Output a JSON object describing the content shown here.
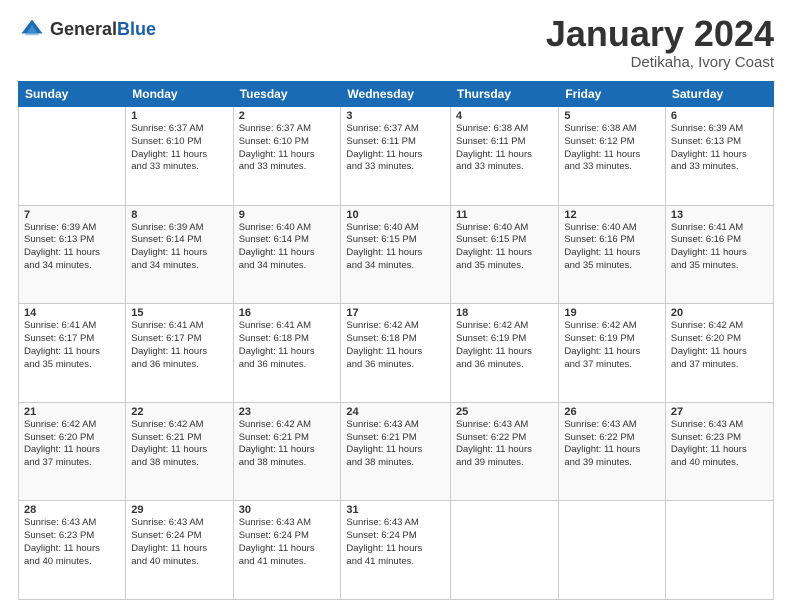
{
  "logo": {
    "general": "General",
    "blue": "Blue"
  },
  "title": "January 2024",
  "location": "Detikaha, Ivory Coast",
  "days_header": [
    "Sunday",
    "Monday",
    "Tuesday",
    "Wednesday",
    "Thursday",
    "Friday",
    "Saturday"
  ],
  "weeks": [
    [
      {
        "day": "",
        "sunrise": "",
        "sunset": "",
        "daylight": ""
      },
      {
        "day": "1",
        "sunrise": "Sunrise: 6:37 AM",
        "sunset": "Sunset: 6:10 PM",
        "daylight": "Daylight: 11 hours and 33 minutes."
      },
      {
        "day": "2",
        "sunrise": "Sunrise: 6:37 AM",
        "sunset": "Sunset: 6:10 PM",
        "daylight": "Daylight: 11 hours and 33 minutes."
      },
      {
        "day": "3",
        "sunrise": "Sunrise: 6:37 AM",
        "sunset": "Sunset: 6:11 PM",
        "daylight": "Daylight: 11 hours and 33 minutes."
      },
      {
        "day": "4",
        "sunrise": "Sunrise: 6:38 AM",
        "sunset": "Sunset: 6:11 PM",
        "daylight": "Daylight: 11 hours and 33 minutes."
      },
      {
        "day": "5",
        "sunrise": "Sunrise: 6:38 AM",
        "sunset": "Sunset: 6:12 PM",
        "daylight": "Daylight: 11 hours and 33 minutes."
      },
      {
        "day": "6",
        "sunrise": "Sunrise: 6:39 AM",
        "sunset": "Sunset: 6:13 PM",
        "daylight": "Daylight: 11 hours and 33 minutes."
      }
    ],
    [
      {
        "day": "7",
        "sunrise": "Sunrise: 6:39 AM",
        "sunset": "Sunset: 6:13 PM",
        "daylight": "Daylight: 11 hours and 34 minutes."
      },
      {
        "day": "8",
        "sunrise": "Sunrise: 6:39 AM",
        "sunset": "Sunset: 6:14 PM",
        "daylight": "Daylight: 11 hours and 34 minutes."
      },
      {
        "day": "9",
        "sunrise": "Sunrise: 6:40 AM",
        "sunset": "Sunset: 6:14 PM",
        "daylight": "Daylight: 11 hours and 34 minutes."
      },
      {
        "day": "10",
        "sunrise": "Sunrise: 6:40 AM",
        "sunset": "Sunset: 6:15 PM",
        "daylight": "Daylight: 11 hours and 34 minutes."
      },
      {
        "day": "11",
        "sunrise": "Sunrise: 6:40 AM",
        "sunset": "Sunset: 6:15 PM",
        "daylight": "Daylight: 11 hours and 35 minutes."
      },
      {
        "day": "12",
        "sunrise": "Sunrise: 6:40 AM",
        "sunset": "Sunset: 6:16 PM",
        "daylight": "Daylight: 11 hours and 35 minutes."
      },
      {
        "day": "13",
        "sunrise": "Sunrise: 6:41 AM",
        "sunset": "Sunset: 6:16 PM",
        "daylight": "Daylight: 11 hours and 35 minutes."
      }
    ],
    [
      {
        "day": "14",
        "sunrise": "Sunrise: 6:41 AM",
        "sunset": "Sunset: 6:17 PM",
        "daylight": "Daylight: 11 hours and 35 minutes."
      },
      {
        "day": "15",
        "sunrise": "Sunrise: 6:41 AM",
        "sunset": "Sunset: 6:17 PM",
        "daylight": "Daylight: 11 hours and 36 minutes."
      },
      {
        "day": "16",
        "sunrise": "Sunrise: 6:41 AM",
        "sunset": "Sunset: 6:18 PM",
        "daylight": "Daylight: 11 hours and 36 minutes."
      },
      {
        "day": "17",
        "sunrise": "Sunrise: 6:42 AM",
        "sunset": "Sunset: 6:18 PM",
        "daylight": "Daylight: 11 hours and 36 minutes."
      },
      {
        "day": "18",
        "sunrise": "Sunrise: 6:42 AM",
        "sunset": "Sunset: 6:19 PM",
        "daylight": "Daylight: 11 hours and 36 minutes."
      },
      {
        "day": "19",
        "sunrise": "Sunrise: 6:42 AM",
        "sunset": "Sunset: 6:19 PM",
        "daylight": "Daylight: 11 hours and 37 minutes."
      },
      {
        "day": "20",
        "sunrise": "Sunrise: 6:42 AM",
        "sunset": "Sunset: 6:20 PM",
        "daylight": "Daylight: 11 hours and 37 minutes."
      }
    ],
    [
      {
        "day": "21",
        "sunrise": "Sunrise: 6:42 AM",
        "sunset": "Sunset: 6:20 PM",
        "daylight": "Daylight: 11 hours and 37 minutes."
      },
      {
        "day": "22",
        "sunrise": "Sunrise: 6:42 AM",
        "sunset": "Sunset: 6:21 PM",
        "daylight": "Daylight: 11 hours and 38 minutes."
      },
      {
        "day": "23",
        "sunrise": "Sunrise: 6:42 AM",
        "sunset": "Sunset: 6:21 PM",
        "daylight": "Daylight: 11 hours and 38 minutes."
      },
      {
        "day": "24",
        "sunrise": "Sunrise: 6:43 AM",
        "sunset": "Sunset: 6:21 PM",
        "daylight": "Daylight: 11 hours and 38 minutes."
      },
      {
        "day": "25",
        "sunrise": "Sunrise: 6:43 AM",
        "sunset": "Sunset: 6:22 PM",
        "daylight": "Daylight: 11 hours and 39 minutes."
      },
      {
        "day": "26",
        "sunrise": "Sunrise: 6:43 AM",
        "sunset": "Sunset: 6:22 PM",
        "daylight": "Daylight: 11 hours and 39 minutes."
      },
      {
        "day": "27",
        "sunrise": "Sunrise: 6:43 AM",
        "sunset": "Sunset: 6:23 PM",
        "daylight": "Daylight: 11 hours and 40 minutes."
      }
    ],
    [
      {
        "day": "28",
        "sunrise": "Sunrise: 6:43 AM",
        "sunset": "Sunset: 6:23 PM",
        "daylight": "Daylight: 11 hours and 40 minutes."
      },
      {
        "day": "29",
        "sunrise": "Sunrise: 6:43 AM",
        "sunset": "Sunset: 6:24 PM",
        "daylight": "Daylight: 11 hours and 40 minutes."
      },
      {
        "day": "30",
        "sunrise": "Sunrise: 6:43 AM",
        "sunset": "Sunset: 6:24 PM",
        "daylight": "Daylight: 11 hours and 41 minutes."
      },
      {
        "day": "31",
        "sunrise": "Sunrise: 6:43 AM",
        "sunset": "Sunset: 6:24 PM",
        "daylight": "Daylight: 11 hours and 41 minutes."
      },
      {
        "day": "",
        "sunrise": "",
        "sunset": "",
        "daylight": ""
      },
      {
        "day": "",
        "sunrise": "",
        "sunset": "",
        "daylight": ""
      },
      {
        "day": "",
        "sunrise": "",
        "sunset": "",
        "daylight": ""
      }
    ]
  ]
}
